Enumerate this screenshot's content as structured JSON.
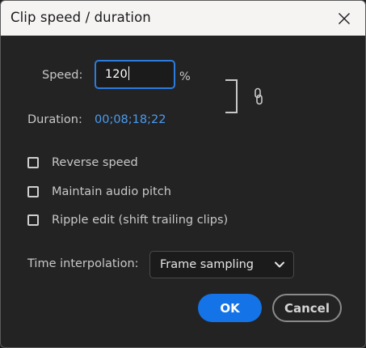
{
  "dialog": {
    "title": "Clip speed / duration",
    "close_icon": "close-icon"
  },
  "speed": {
    "label": "Speed:",
    "value": "120",
    "unit": "%"
  },
  "duration": {
    "label": "Duration:",
    "value": "00;08;18;22"
  },
  "link_icon": "chain-link-icon",
  "options": [
    {
      "label": "Reverse speed",
      "checked": false
    },
    {
      "label": "Maintain audio pitch",
      "checked": false
    },
    {
      "label": "Ripple edit (shift trailing clips)",
      "checked": false
    }
  ],
  "time_interpolation": {
    "label": "Time interpolation:",
    "selected": "Frame sampling"
  },
  "buttons": {
    "ok": "OK",
    "cancel": "Cancel"
  },
  "colors": {
    "accent": "#1473e6",
    "focus_border": "#2c7bdd",
    "link_value": "#4b9cf0",
    "background": "#232323",
    "titlebar": "#f6f3f3"
  }
}
